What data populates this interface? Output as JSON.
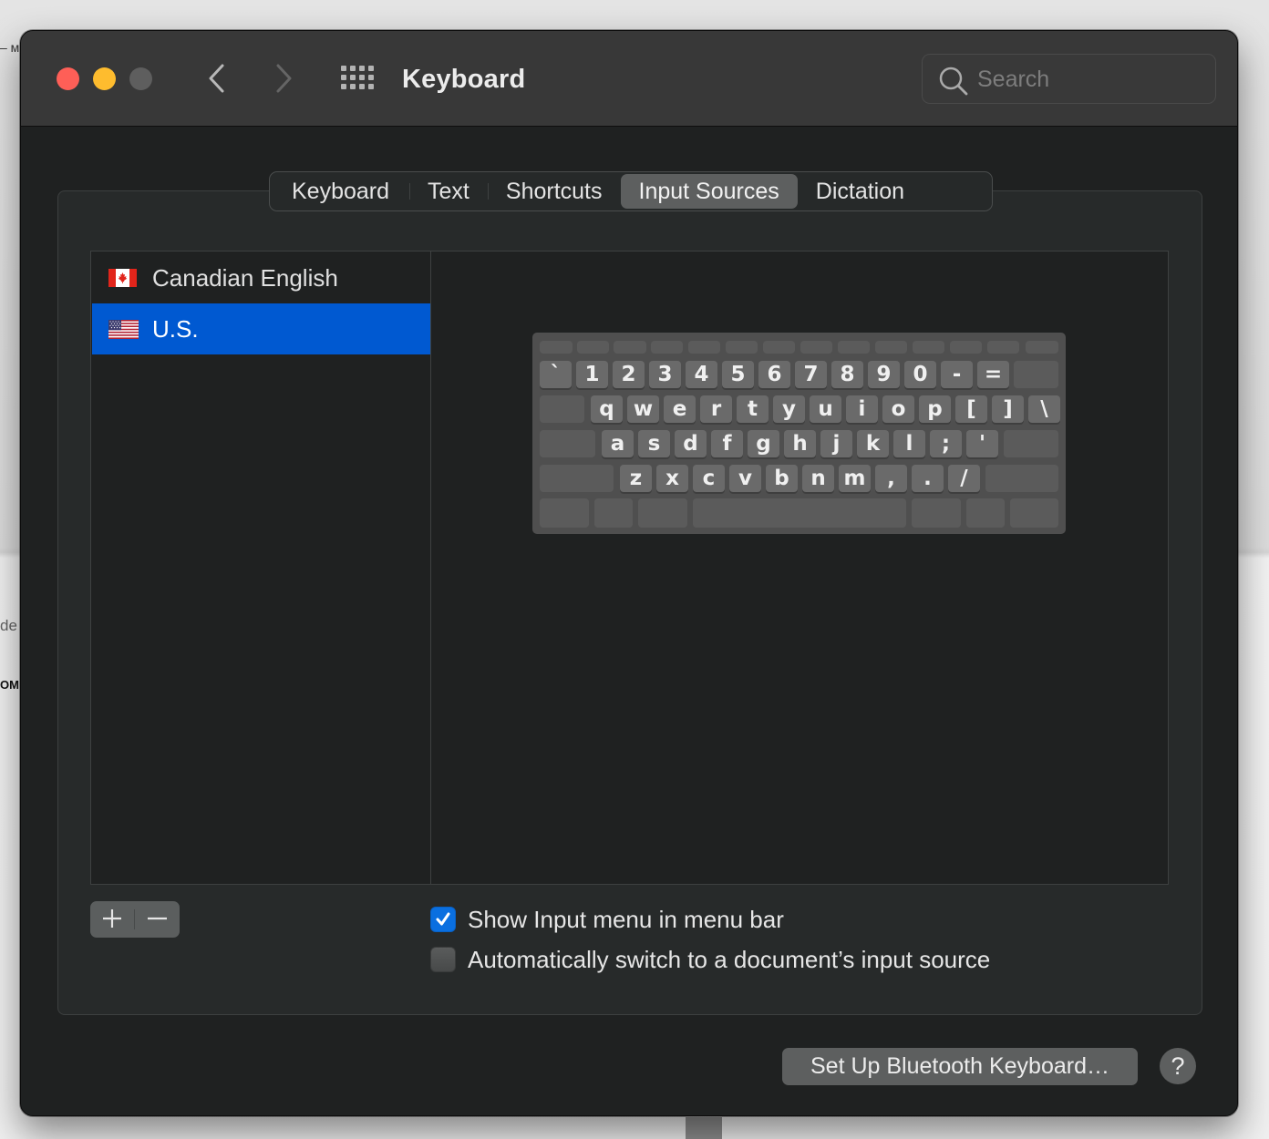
{
  "background": {
    "fragments": [
      "– м",
      "de",
      "OM"
    ]
  },
  "window": {
    "title": "Keyboard",
    "traffic_lights": {
      "close": "#fe5f57",
      "minimize": "#febc2e",
      "zoom": "#5e5e5e"
    },
    "back_icon": "chevron-left-icon",
    "forward_icon": "chevron-right-icon",
    "show_all_icon": "grid-icon",
    "search": {
      "placeholder": "Search",
      "value": "",
      "icon": "search-icon"
    }
  },
  "tabs": [
    {
      "label": "Keyboard",
      "active": false
    },
    {
      "label": "Text",
      "active": false
    },
    {
      "label": "Shortcuts",
      "active": false
    },
    {
      "label": "Input Sources",
      "active": true
    },
    {
      "label": "Dictation",
      "active": false
    }
  ],
  "input_sources": [
    {
      "label": "Canadian English",
      "flag": "canada-flag-icon",
      "selected": false
    },
    {
      "label": "U.S.",
      "flag": "us-flag-icon",
      "selected": true
    }
  ],
  "keyboard_layout": {
    "rows": [
      [
        "`",
        "1",
        "2",
        "3",
        "4",
        "5",
        "6",
        "7",
        "8",
        "9",
        "0",
        "-",
        "="
      ],
      [
        "q",
        "w",
        "e",
        "r",
        "t",
        "y",
        "u",
        "i",
        "o",
        "p",
        "[",
        "]",
        "\\"
      ],
      [
        "a",
        "s",
        "d",
        "f",
        "g",
        "h",
        "j",
        "k",
        "l",
        ";",
        "'"
      ],
      [
        "z",
        "x",
        "c",
        "v",
        "b",
        "n",
        "m",
        ",",
        ".",
        "/"
      ]
    ]
  },
  "list_controls": {
    "add_label": "+",
    "remove_label": "−"
  },
  "options": [
    {
      "label": "Show Input menu in menu bar",
      "checked": true
    },
    {
      "label": "Automatically switch to a document’s input source",
      "checked": false
    }
  ],
  "footer": {
    "bluetooth_button": "Set Up Bluetooth Keyboard…",
    "help_label": "?"
  },
  "colors": {
    "selection": "#0059d1",
    "checkbox_on": "#0a6fe0",
    "tab_active": "#5d5f5f"
  }
}
